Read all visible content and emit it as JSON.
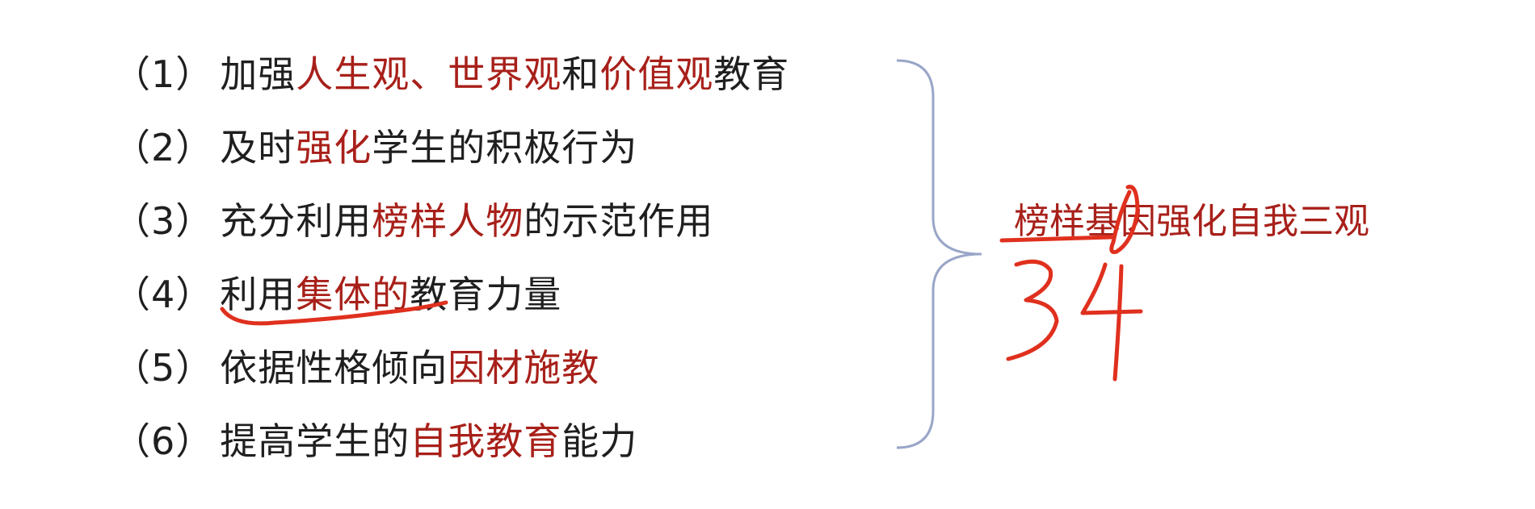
{
  "items": [
    {
      "num": "（1）",
      "parts": [
        {
          "text": "加强",
          "red": false
        },
        {
          "text": "人生观、世界观",
          "red": true
        },
        {
          "text": "和",
          "red": false
        },
        {
          "text": "价值观",
          "red": true
        },
        {
          "text": "教育",
          "red": false
        }
      ]
    },
    {
      "num": "（2）",
      "parts": [
        {
          "text": "及时",
          "red": false
        },
        {
          "text": "强化",
          "red": true
        },
        {
          "text": "学生的积极行为",
          "red": false
        }
      ]
    },
    {
      "num": "（3）",
      "parts": [
        {
          "text": "充分利用",
          "red": false
        },
        {
          "text": "榜样人物",
          "red": true
        },
        {
          "text": "的示范作用",
          "red": false
        }
      ]
    },
    {
      "num": "（4）",
      "parts": [
        {
          "text": "利用",
          "red": false
        },
        {
          "text": "集体的",
          "red": true
        },
        {
          "text": "教育力量",
          "red": false
        }
      ]
    },
    {
      "num": "（5）",
      "parts": [
        {
          "text": "依据性格倾向",
          "red": false
        },
        {
          "text": "因材施教",
          "red": true
        }
      ]
    },
    {
      "num": "（6）",
      "parts": [
        {
          "text": "提高学生的",
          "red": false
        },
        {
          "text": "自我教育",
          "red": true
        },
        {
          "text": "能力",
          "red": false
        }
      ]
    }
  ],
  "summary": "榜样基因强化自我三观",
  "handwriting": "34",
  "colors": {
    "text": "#1f1f1f",
    "highlight": "#a8201a",
    "ink": "#e0301e",
    "brace": "#9aa6c8"
  }
}
